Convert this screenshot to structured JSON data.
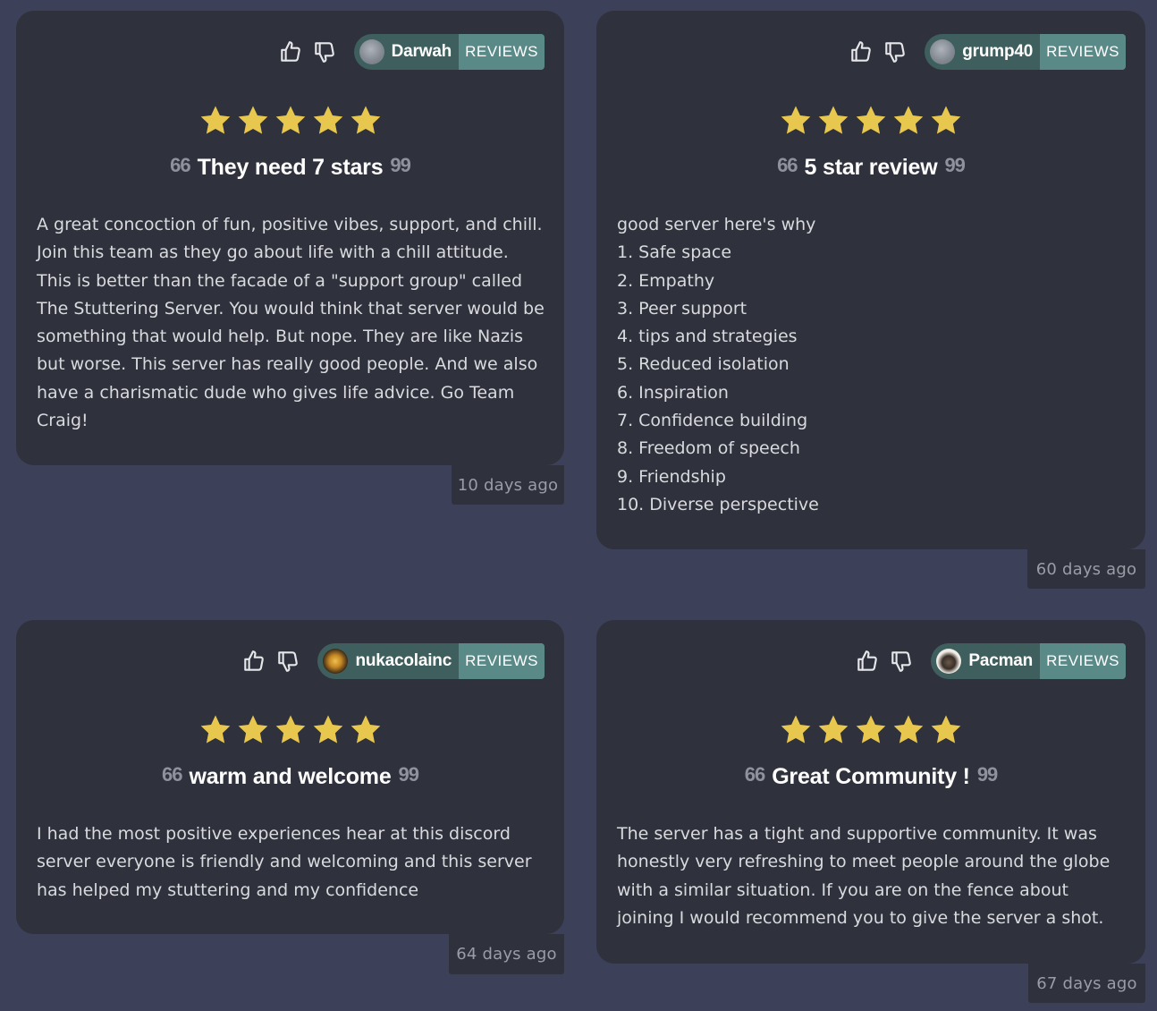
{
  "reviews": [
    {
      "author": "Darwah",
      "tag": "REVIEWS",
      "avatar": "gray-circle-avatar",
      "rating": 5,
      "title": "They need 7 stars",
      "body": "A great concoction of fun, positive vibes, support, and chill. Join this team as they go about life with a chill attitude. This is better than the facade of a \"support group\" called The Stuttering Server. You would think that server would be something that would help. But nope. They are like Nazis but worse. This server has really good people. And we also have a charismatic dude who gives life advice. Go Team Craig!",
      "time": "10 days ago"
    },
    {
      "author": "grump40",
      "tag": "REVIEWS",
      "avatar": "gray-circle-avatar",
      "rating": 5,
      "title": "5 star review",
      "body": "good server here's why\n1. Safe space\n2. Empathy\n3. Peer support\n4. tips and strategies\n5. Reduced isolation\n6. Inspiration\n7. Confidence building\n8. Freedom of speech\n9. Friendship\n10. Diverse perspective",
      "time": "60 days ago"
    },
    {
      "author": "nukacolainc",
      "tag": "REVIEWS",
      "avatar": "bottle-cap-avatar",
      "rating": 5,
      "title": "warm and welcome",
      "body": "I had the most positive experiences hear at this discord server everyone is friendly and welcoming and this server has helped my stuttering and my confidence",
      "time": "64 days ago"
    },
    {
      "author": "Pacman",
      "tag": "REVIEWS",
      "avatar": "figure-avatar",
      "rating": 5,
      "title": "Great Community !",
      "body": "The server has a tight and supportive community. It was honestly very refreshing to meet people around the globe with a similar situation. If you are on the fence about joining I would recommend you to give the server a shot.",
      "time": "67 days ago"
    }
  ],
  "quote_open": "66",
  "quote_close": "99",
  "colors": {
    "background": "#3c4059",
    "card": "#2f313c",
    "star": "#e8c74e",
    "tag": "#5a8a88",
    "pill": "#3e5f5e"
  },
  "icons": {
    "vote_up": "thumbs-up-icon",
    "vote_down": "thumbs-down-icon",
    "rating": "star-icon"
  }
}
